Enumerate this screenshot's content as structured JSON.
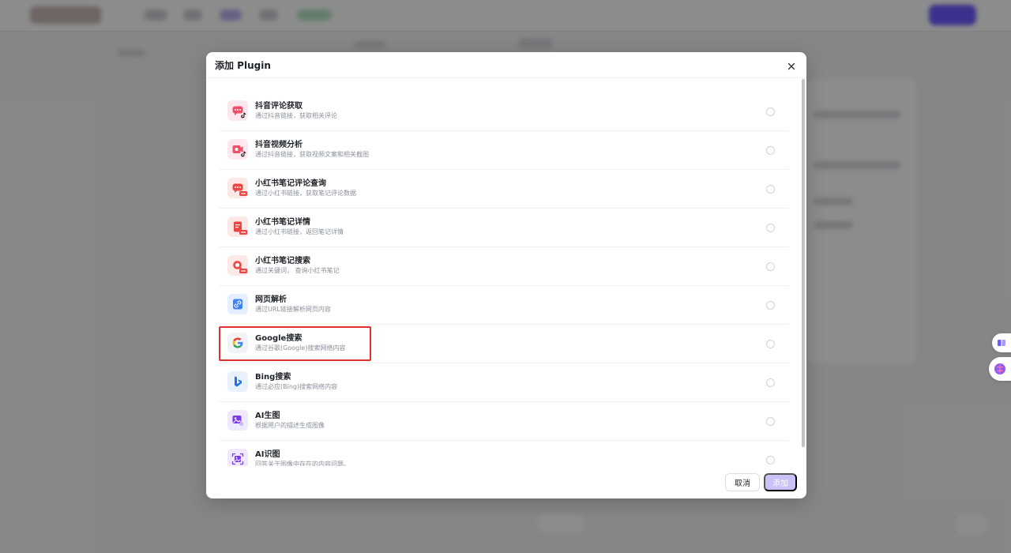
{
  "modal": {
    "title": "添加 Plugin",
    "cancel_label": "取消",
    "add_label": "添加"
  },
  "plugins": [
    {
      "name": "抖音评论获取",
      "desc": "通过抖音链接，获取相关评论",
      "icon": "douyin-comment-icon",
      "color": "#f04f6c",
      "bg": "#fde9ed",
      "badge": "tiktok"
    },
    {
      "name": "抖音视频分析",
      "desc": "通过抖音链接，获取视频文案和相关截图",
      "icon": "douyin-video-icon",
      "color": "#f04f6c",
      "bg": "#fde9ed",
      "badge": "tiktok"
    },
    {
      "name": "小红书笔记评论查询",
      "desc": "通过小红书链接，获取笔记评论数据",
      "icon": "xhs-comment-icon",
      "color": "#ef4444",
      "bg": "#fde8e8",
      "badge": "xhs"
    },
    {
      "name": "小红书笔记详情",
      "desc": "通过小红书链接，返回笔记详情",
      "icon": "xhs-note-icon",
      "color": "#ef4444",
      "bg": "#fde8e8",
      "badge": "xhs"
    },
    {
      "name": "小红书笔记搜索",
      "desc": "通过关键词， 查询小红书笔记",
      "icon": "xhs-search-icon",
      "color": "#ef4444",
      "bg": "#fde8e8",
      "badge": "xhs"
    },
    {
      "name": "网页解析",
      "desc": "通过URL链接解析网页内容",
      "icon": "link-icon",
      "color": "#3b82f6",
      "bg": "#e6efff",
      "badge": ""
    },
    {
      "name": "Google搜索",
      "desc": "通过谷歌(Google)搜索网络内容",
      "icon": "google-icon",
      "color": "#4285f4",
      "bg": "#f1f3f8",
      "badge": "",
      "highlighted": true
    },
    {
      "name": "Bing搜索",
      "desc": "通过必应(Bing)搜索网络内容",
      "icon": "bing-icon",
      "color": "#1a73e8",
      "bg": "#e8f1fd",
      "badge": ""
    },
    {
      "name": "AI生图",
      "desc": "根据用户的描述生成图像",
      "icon": "ai-image-gen-icon",
      "color": "#7c3aed",
      "bg": "#efe9fd",
      "badge": ""
    },
    {
      "name": "AI识图",
      "desc": "回答关于图像中存在的内容问题。",
      "icon": "ai-image-recognition-icon",
      "color": "#7c3aed",
      "bg": "#efe9fd",
      "badge": ""
    }
  ]
}
